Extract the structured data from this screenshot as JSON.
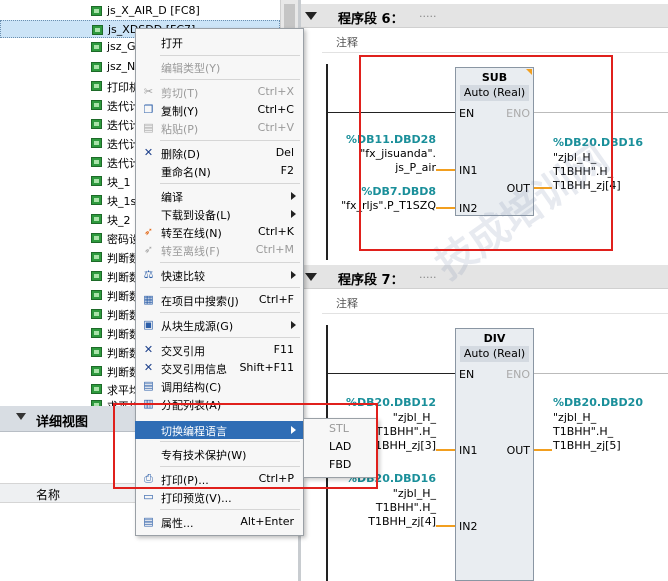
{
  "tree": {
    "items": [
      {
        "label": "js_X_AIR_D [FC8]",
        "selected": false
      },
      {
        "label": "js_XDSDD [FC7]",
        "selected": true
      },
      {
        "label": "jsz_G",
        "selected": false
      },
      {
        "label": "jsz_N",
        "selected": false
      },
      {
        "label": "打印机",
        "selected": false
      },
      {
        "label": "迭代计",
        "selected": false
      },
      {
        "label": "迭代计",
        "selected": false
      },
      {
        "label": "迭代计",
        "selected": false
      },
      {
        "label": "迭代计",
        "selected": false
      },
      {
        "label": "块_1",
        "selected": false
      },
      {
        "label": "块_1s",
        "selected": false
      },
      {
        "label": "块_2",
        "selected": false
      },
      {
        "label": "密码设",
        "selected": false
      },
      {
        "label": "判断数",
        "selected": false
      },
      {
        "label": "判断数",
        "selected": false
      },
      {
        "label": "判断数",
        "selected": false
      },
      {
        "label": "判断数",
        "selected": false
      },
      {
        "label": "判断数",
        "selected": false
      },
      {
        "label": "判断数",
        "selected": false
      },
      {
        "label": "判断数",
        "selected": false
      },
      {
        "label": "求平均",
        "selected": false
      },
      {
        "label": "求平均",
        "selected": false
      }
    ]
  },
  "detail": {
    "title": "详细视图",
    "column_name": "名称"
  },
  "menu": {
    "items": [
      {
        "label": "打开",
        "shortcut": "",
        "icon": "",
        "disabled": false,
        "submenu": false
      },
      {
        "label": "编辑类型(Y)",
        "shortcut": "",
        "icon": "",
        "disabled": true,
        "submenu": false
      },
      {
        "label": "剪切(T)",
        "shortcut": "Ctrl+X",
        "icon": "scissors-icon",
        "disabled": true,
        "submenu": false
      },
      {
        "label": "复制(Y)",
        "shortcut": "Ctrl+C",
        "icon": "copy-icon",
        "disabled": false,
        "submenu": false
      },
      {
        "label": "粘贴(P)",
        "shortcut": "Ctrl+V",
        "icon": "paste-icon",
        "disabled": true,
        "submenu": false
      },
      {
        "label": "删除(D)",
        "shortcut": "Del",
        "icon": "delete-x-icon",
        "disabled": false,
        "submenu": false
      },
      {
        "label": "重命名(N)",
        "shortcut": "F2",
        "icon": "",
        "disabled": false,
        "submenu": false
      },
      {
        "label": "编译",
        "shortcut": "",
        "icon": "",
        "disabled": false,
        "submenu": true
      },
      {
        "label": "下载到设备(L)",
        "shortcut": "",
        "icon": "",
        "disabled": false,
        "submenu": true
      },
      {
        "label": "转至在线(N)",
        "shortcut": "Ctrl+K",
        "icon": "go-online-icon",
        "disabled": false,
        "submenu": false
      },
      {
        "label": "转至离线(F)",
        "shortcut": "Ctrl+M",
        "icon": "go-offline-icon",
        "disabled": true,
        "submenu": false
      },
      {
        "label": "快速比较",
        "shortcut": "",
        "icon": "compare-scale-icon",
        "disabled": false,
        "submenu": true
      },
      {
        "label": "在项目中搜索(J)",
        "shortcut": "Ctrl+F",
        "icon": "search-icon",
        "disabled": false,
        "submenu": false
      },
      {
        "label": "从块生成源(G)",
        "shortcut": "",
        "icon": "generate-source-icon",
        "disabled": false,
        "submenu": true
      },
      {
        "label": "交叉引用",
        "shortcut": "F11",
        "icon": "cross-reference-icon",
        "disabled": false,
        "submenu": false
      },
      {
        "label": "交叉引用信息",
        "shortcut": "Shift+F11",
        "icon": "cross-reference-info-icon",
        "disabled": false,
        "submenu": false
      },
      {
        "label": "调用结构(C)",
        "shortcut": "",
        "icon": "call-structure-icon",
        "disabled": false,
        "submenu": false
      },
      {
        "label": "分配列表(A)",
        "shortcut": "",
        "icon": "assignment-list-icon",
        "disabled": false,
        "submenu": false
      },
      {
        "label": "切换编程语言",
        "shortcut": "",
        "icon": "",
        "disabled": false,
        "submenu": true,
        "highlighted": true
      },
      {
        "label": "专有技术保护(W)",
        "shortcut": "",
        "icon": "",
        "disabled": false,
        "submenu": false
      },
      {
        "label": "打印(P)...",
        "shortcut": "Ctrl+P",
        "icon": "printer-icon",
        "disabled": false,
        "submenu": false
      },
      {
        "label": "打印预览(V)...",
        "shortcut": "",
        "icon": "print-preview-icon",
        "disabled": false,
        "submenu": false
      },
      {
        "label": "属性...",
        "shortcut": "Alt+Enter",
        "icon": "properties-icon",
        "disabled": false,
        "submenu": false
      }
    ],
    "submenu": [
      "STL",
      "LAD",
      "FBD"
    ]
  },
  "editor": {
    "segment6": {
      "title": "程序段 6：",
      "dots": ".....",
      "comment": "注释",
      "block": {
        "name": "SUB",
        "type": "Auto (Real)",
        "en": "EN",
        "eno": "ENO",
        "in1": "IN1",
        "in2": "IN2",
        "out": "OUT"
      },
      "in1_addr": "%DB11.DBD28",
      "in1_sym1": "\"fx_jisuanda\".",
      "in1_sym2": "js_P_air",
      "in2_addr": "%DB7.DBD8",
      "in2_sym": "\"fx_rljs\".P_T1SZQ",
      "out_addr": "%DB20.DBD16",
      "out_sym1": "\"zjbl_H_",
      "out_sym2": "T1BHH\".H_",
      "out_sym3": "T1BHH_zj[4]"
    },
    "segment7": {
      "title": "程序段 7：",
      "dots": ".....",
      "comment": "注释",
      "block": {
        "name": "DIV",
        "type": "Auto (Real)",
        "en": "EN",
        "eno": "ENO",
        "in1": "IN1",
        "in2": "IN2",
        "out": "OUT"
      },
      "in1_addr": "%DB20.DBD12",
      "in1_sym1": "\"zjbl_H_",
      "in1_sym2": "T1BHH\".H_",
      "in1_sym3": "T1BHH_zj[3]",
      "in2_addr": "%DB20.DBD16",
      "in2_sym1": "\"zjbl_H_",
      "in2_sym2": "T1BHH\".H_",
      "in2_sym3": "T1BHH_zj[4]",
      "out_addr": "%DB20.DBD20",
      "out_sym1": "\"zjbl_H_",
      "out_sym2": "T1BHH\".H_",
      "out_sym3": "T1BHH_zj[5]"
    }
  },
  "colors": {
    "highlight_box": "#e0201c",
    "menu_highlight": "#2f6db5",
    "address_teal": "#1a8f9a",
    "wire_orange": "#f29f1f"
  }
}
